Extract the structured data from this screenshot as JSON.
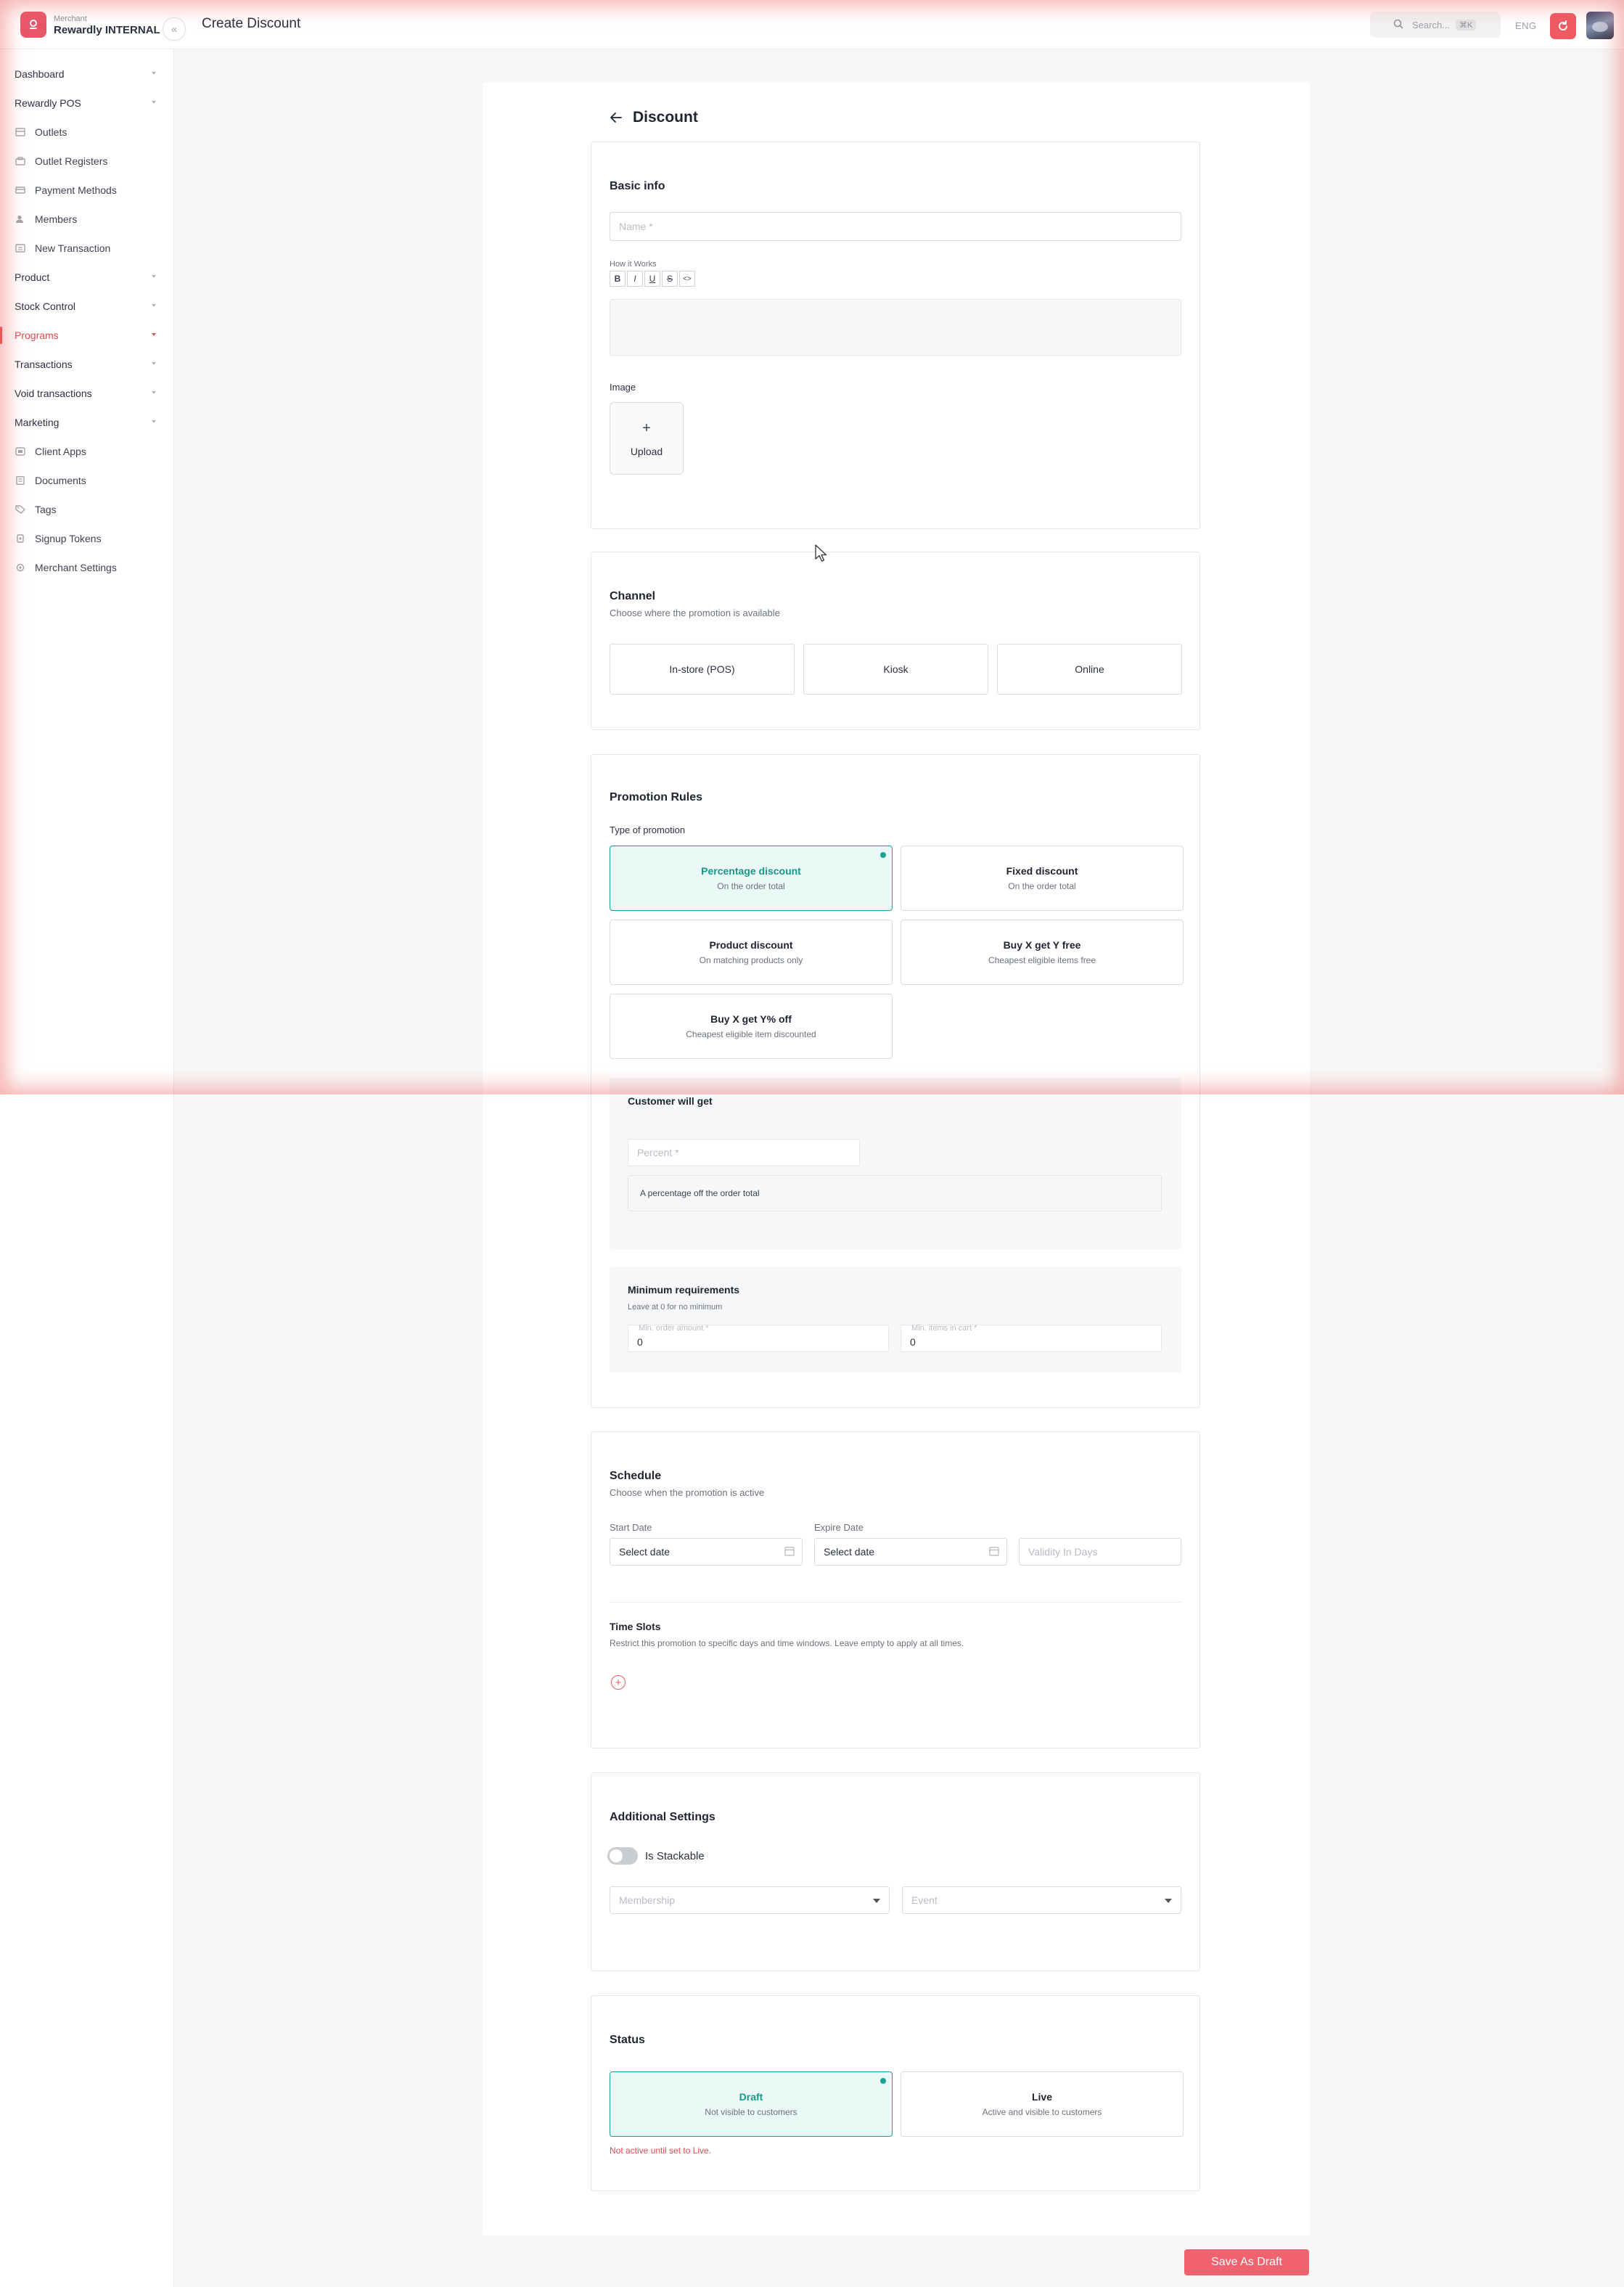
{
  "header": {
    "brand_small": "Merchant",
    "brand_name": "Rewardly INTERNAL",
    "page_title": "Create Discount",
    "search_placeholder": "Search...",
    "search_shortcut": "⌘K",
    "language": "ENG"
  },
  "sidebar": {
    "items": [
      {
        "label": "Dashboard"
      },
      {
        "label": "Rewardly POS"
      },
      {
        "label": "Outlets"
      },
      {
        "label": "Outlet Registers"
      },
      {
        "label": "Payment Methods"
      },
      {
        "label": "Members"
      },
      {
        "label": "New Transaction"
      },
      {
        "label": "Product"
      },
      {
        "label": "Stock Control"
      },
      {
        "label": "Programs"
      },
      {
        "label": "Transactions"
      },
      {
        "label": "Void transactions"
      },
      {
        "label": "Marketing"
      },
      {
        "label": "Client Apps"
      },
      {
        "label": "Documents"
      },
      {
        "label": "Tags"
      },
      {
        "label": "Signup Tokens"
      },
      {
        "label": "Merchant Settings"
      }
    ]
  },
  "form": {
    "title": "Discount",
    "basic": {
      "title": "Basic info",
      "name_placeholder": "Name *",
      "how_it_works_label": "How it Works",
      "toolbar": [
        "B",
        "I",
        "U",
        "S",
        "<>"
      ],
      "image_label": "Image",
      "upload_plus": "+",
      "upload_label": "Upload"
    },
    "channel": {
      "title": "Channel",
      "subtitle": "Choose where the promotion is available",
      "options": [
        "In-store (POS)",
        "Kiosk",
        "Online"
      ]
    },
    "promotion": {
      "title": "Promotion Rules",
      "type_label": "Type of promotion",
      "options": [
        {
          "title": "Percentage discount",
          "desc": "On the order total",
          "selected": true
        },
        {
          "title": "Fixed discount",
          "desc": "On the order total",
          "selected": false
        },
        {
          "title": "Product discount",
          "desc": "On matching products only",
          "selected": false
        },
        {
          "title": "Buy X get Y free",
          "desc": "Cheapest eligible items free",
          "selected": false
        },
        {
          "title": "Buy X get Y% off",
          "desc": "Cheapest eligible item discounted",
          "selected": false
        }
      ],
      "customer_gets": {
        "title": "Customer will get",
        "percent_placeholder": "Percent *",
        "note": "A percentage off the order total"
      },
      "minimum": {
        "title": "Minimum requirements",
        "subtitle": "Leave at 0 for no minimum",
        "min_order_label": "Min. order amount *",
        "min_order_value": "0",
        "min_items_label": "Min. items in cart *",
        "min_items_value": "0"
      }
    },
    "schedule": {
      "title": "Schedule",
      "subtitle": "Choose when the promotion is active",
      "start_label": "Start Date",
      "start_value": "Select date",
      "expire_label": "Expire Date",
      "expire_value": "Select date",
      "validity_placeholder": "Validity In Days",
      "time_slots_title": "Time Slots",
      "time_slots_desc": "Restrict this promotion to specific days and time windows. Leave empty to apply at all times.",
      "add_symbol": "+"
    },
    "additional": {
      "title": "Additional Settings",
      "stackable_label": "Is Stackable",
      "stackable_on": false,
      "membership_placeholder": "Membership",
      "event_placeholder": "Event"
    },
    "status": {
      "title": "Status",
      "options": [
        {
          "title": "Draft",
          "desc": "Not visible to customers",
          "selected": true
        },
        {
          "title": "Live",
          "desc": "Active and visible to customers",
          "selected": false
        }
      ],
      "warning": "Not active until set to Live."
    },
    "save_label": "Save As Draft"
  },
  "colors": {
    "accent": "#ef5a62",
    "selected_teal": "#17a393",
    "selected_bg": "#eaf8f6",
    "active_nav": "#e5484d"
  }
}
